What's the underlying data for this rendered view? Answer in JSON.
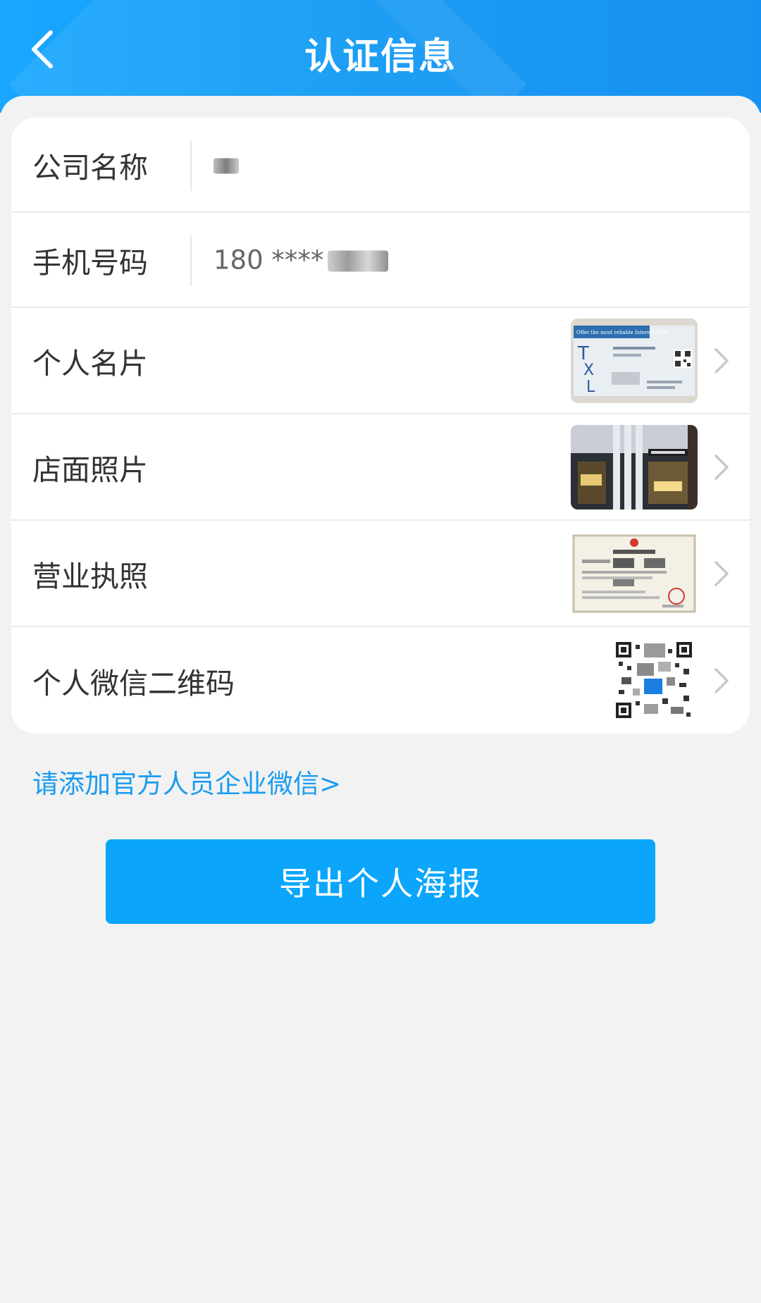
{
  "header": {
    "title": "认证信息",
    "back_icon": "chevron-left-icon"
  },
  "card": {
    "company": {
      "label": "公司名称",
      "value": "ttt"
    },
    "phone": {
      "label": "手机号码",
      "value": "180 ****"
    },
    "business_card": {
      "label": "个人名片",
      "thumb_text": "Offer the most reliable Internet Link"
    },
    "store_photo": {
      "label": "店面照片"
    },
    "license": {
      "label": "营业执照"
    },
    "wechat_qr": {
      "label": "个人微信二维码"
    }
  },
  "link": {
    "text": "请添加官方人员企业微信>"
  },
  "export_button": {
    "label": "导出个人海报"
  },
  "colors": {
    "header": "#0a97f3",
    "accent": "#0ba6fb",
    "link": "#1a9cf0"
  }
}
